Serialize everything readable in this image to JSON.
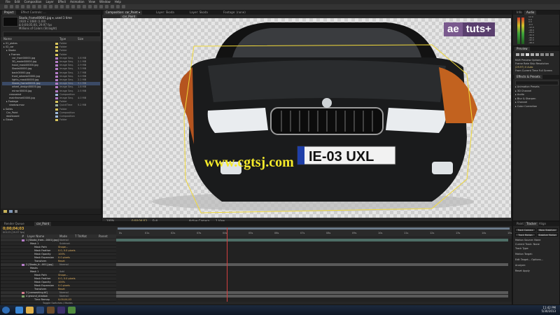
{
  "menu": [
    "File",
    "Edit",
    "Composition",
    "Layer",
    "Effect",
    "Animation",
    "View",
    "Window",
    "Help"
  ],
  "project": {
    "tabs": [
      "Project",
      "Effect Controls: ..."
    ],
    "info_lines": [
      "Skoda_frame00001.jpg ▾, used 1 time",
      "1920 x 1080 (1.00)",
      "Δ 0;00;05;00, 29.97 fps",
      "Millions of Colors (Straight)"
    ],
    "search_placeholder": "",
    "columns": [
      "Name",
      "Type",
      "Size"
    ],
    "items": [
      {
        "name": "01_plates",
        "type": "Folder",
        "size": "",
        "color": "#d9c65c",
        "indent": 0
      },
      {
        "name": "02_car",
        "type": "Folder",
        "size": "",
        "color": "#d9c65c",
        "indent": 0
      },
      {
        "name": "Skoda",
        "type": "Folder",
        "size": "",
        "color": "#d9c65c",
        "indent": 1
      },
      {
        "name": "Frames",
        "type": "Folder",
        "size": "",
        "color": "#d9c65c",
        "indent": 2
      },
      {
        "name": "car_front00000.jpg",
        "type": "Image Seq.",
        "size": "3.6 MB",
        "color": "#b47cc7",
        "indent": 3
      },
      {
        "name": "3D_model00000.jpg",
        "type": "Image Seq.",
        "size": "2.1 MB",
        "color": "#b47cc7",
        "indent": 3
      },
      {
        "name": "hood_mask00000.jpg",
        "type": "Image Seq.",
        "size": "2.9 MB",
        "color": "#b47cc7",
        "indent": 3
      },
      {
        "name": "Skoda00000.jpg",
        "type": "Image Seq.",
        "size": "3.3 MB",
        "color": "#b47cc7",
        "indent": 3
      },
      {
        "name": "back00000.jpg",
        "type": "Image Seq.",
        "size": "2.7 MB",
        "color": "#b47cc7",
        "indent": 3
      },
      {
        "name": "front_wheels00000.jpg",
        "type": "Image Seq.",
        "size": "3.0 MB",
        "color": "#b47cc7",
        "indent": 3
      },
      {
        "name": "lights_mask00000.jpg",
        "type": "Image Seq.",
        "size": "2.2 MB",
        "color": "#b47cc7",
        "indent": 3
      },
      {
        "name": "Skoda_frame00001.jpg",
        "type": "Image Seq.",
        "size": "3.1 MB",
        "color": "#b47cc7",
        "indent": 3,
        "selected": true
      },
      {
        "name": "wheel_design00000.jpg",
        "type": "Image Seq.",
        "size": "1.8 MB",
        "color": "#b47cc7",
        "indent": 3
      },
      {
        "name": "mirror00000.jpg",
        "type": "Image Seq.",
        "size": "2.5 MB",
        "color": "#b47cc7",
        "indent": 3
      },
      {
        "name": "crosswind",
        "type": "Composition",
        "size": "",
        "color": "#9db8d9",
        "indent": 2
      },
      {
        "name": "mainframe00000.jpg",
        "type": "Image Seq.",
        "size": "4.0 MB",
        "color": "#b47cc7",
        "indent": 2
      },
      {
        "name": "Footage",
        "type": "Folder",
        "size": "",
        "color": "#d9c65c",
        "indent": 1
      },
      {
        "name": "shadow.mov",
        "type": "QuickTime",
        "size": "5.2 MB",
        "color": "#9ab0a0",
        "indent": 2
      },
      {
        "name": "Solids",
        "type": "Folder",
        "size": "",
        "color": "#d9c65c",
        "indent": 0
      },
      {
        "name": "Car_Paint",
        "type": "Composition",
        "size": "",
        "color": "#9db8d9",
        "indent": 1
      },
      {
        "name": "dashboard",
        "type": "Composition",
        "size": "",
        "color": "#9db8d9",
        "indent": 1
      },
      {
        "name": "Glows",
        "type": "Folder",
        "size": "",
        "color": "#d9c65c",
        "indent": 0
      }
    ]
  },
  "comp": {
    "tabs": [
      "Composition: car_Paint ▾",
      "Layer: Skoda",
      "Layer: Skoda",
      "Footage: (none)"
    ],
    "sub_tab": "car_Paint",
    "zoom": "100%",
    "timecode": "0;00;04;03",
    "resolution": "Full",
    "view": "Active Camera",
    "views": "1 View"
  },
  "viewer": {
    "watermark": "www.cgtsj.com",
    "plate": "IE-03 UXL",
    "brand_ae": "ae",
    "brand_tuts": "tuts+"
  },
  "info_panel": {
    "tabs": [
      "Info",
      "Audio"
    ],
    "audio_levels": [
      "12.0",
      "6.0",
      "0.0",
      "-6.0",
      "-12.0",
      "-18.0",
      "-24.0",
      "-30.0",
      "-36.0",
      "-42.0",
      "-48.0"
    ]
  },
  "preview": {
    "tabs": [
      "Preview",
      "Effects & Presets"
    ],
    "rows": [
      "Frame Rate  Skip  Resolution",
      "(29.97)  0  Auto",
      "From Current Time   Full Screen",
      "RAM Preview Options"
    ],
    "effects_rows": [
      "▸ Animation Presets",
      "▸ 3D Channel",
      "▸ Audio",
      "▸ Blur & Sharpen",
      "▸ Channel",
      "▸ Color Correction"
    ]
  },
  "tracker": {
    "tabs": [
      "Paint",
      "Tracker",
      "Align"
    ],
    "buttons": [
      "Track Camera",
      "Warp Stabilizer",
      "Track Motion",
      "Stabilize Motion"
    ],
    "rows": [
      "Motion Source:  None",
      "Current Track:  None",
      "Track Type:",
      "Motion Target:",
      "Edit Target...  Options...",
      "Analyze:",
      "Reset   Apply"
    ]
  },
  "timeline": {
    "tabs": [
      "Render Queue",
      "car_Paint"
    ],
    "timecode": "0;00;04;03",
    "fps_line": "00123 (29.97 fps)",
    "columns": [
      "#",
      "Layer Name",
      "Mode",
      "T TrkMat",
      "Parent"
    ],
    "ruler": [
      "0s",
      "01s",
      "02s",
      "03s",
      "04s",
      "05s",
      "06s",
      "07s",
      "08s",
      "09s",
      "10s",
      "11s",
      "12s",
      "13s",
      "14s",
      "15s"
    ],
    "playhead_pct": 0.28,
    "layers": [
      {
        "num": "1",
        "name": "[Skoda_fram...0001].jpg]",
        "mode": "Normal",
        "color": "#b47cc7",
        "kind": "layer"
      },
      {
        "name": "Mask 1",
        "mode": "Subtract",
        "kind": "sub"
      },
      {
        "name": "Mask Path",
        "value": "Shape...",
        "kind": "prop"
      },
      {
        "name": "Mask Feather",
        "value": "0.0, 0.0 pixels",
        "kind": "prop"
      },
      {
        "name": "Mask Opacity",
        "value": "100%",
        "kind": "prop"
      },
      {
        "name": "Mask Expansion",
        "value": "0.0 pixels",
        "kind": "prop"
      },
      {
        "name": "Transform",
        "value": "Reset",
        "kind": "prop"
      },
      {
        "num": "2",
        "name": "[Skoda_fr...001].jpg]",
        "mode": "Normal",
        "color": "#b47cc7",
        "kind": "layer"
      },
      {
        "name": "Masks",
        "kind": "sub"
      },
      {
        "name": "Mask 1",
        "mode": "Add",
        "kind": "sub"
      },
      {
        "name": "Mask Path",
        "value": "Shape...",
        "kind": "prop"
      },
      {
        "name": "Mask Feather",
        "value": "0.0, 0.0 pixels",
        "kind": "prop"
      },
      {
        "name": "Mask Opacity",
        "value": "100%",
        "kind": "prop"
      },
      {
        "name": "Mask Expansion",
        "value": "0.0 pixels",
        "kind": "prop"
      },
      {
        "name": "Transform",
        "value": "Reset",
        "kind": "prop"
      },
      {
        "num": "3",
        "name": "[carwashing.tif]",
        "mode": "Normal",
        "color": "#d17b8b",
        "kind": "layer"
      },
      {
        "num": "4",
        "name": "ground_shadow",
        "mode": "Normal",
        "color": "#7fa36b",
        "kind": "layer"
      },
      {
        "name": "Time Remap",
        "value": "0;00;04;03",
        "kind": "prop"
      }
    ],
    "bottom": "Toggle Switches / Modes"
  },
  "taskbar": {
    "time": "11:42 PM",
    "date": "5/30/2013",
    "apps": [
      {
        "name": "start-orb",
        "color": "#2f6db5"
      },
      {
        "name": "ie-icon",
        "color": "#3a86d4"
      },
      {
        "name": "explorer-icon",
        "color": "#e0b04a"
      },
      {
        "name": "ps-icon",
        "color": "#2d4a7a"
      },
      {
        "name": "bridge-icon",
        "color": "#6a4a2a"
      },
      {
        "name": "ae-icon",
        "color": "#3d2f6b"
      },
      {
        "name": "media-icon",
        "color": "#4f8a3e"
      }
    ]
  }
}
